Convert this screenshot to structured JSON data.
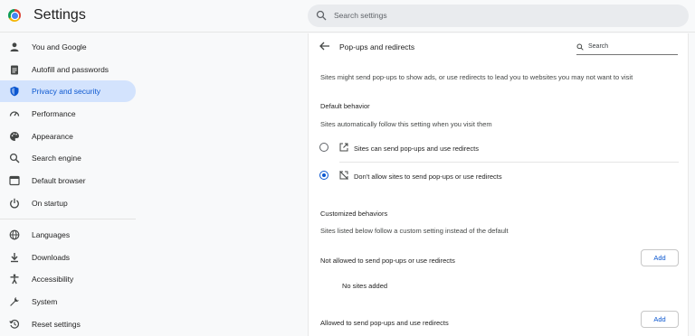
{
  "header": {
    "title": "Settings",
    "search_placeholder": "Search settings"
  },
  "sidebar": {
    "items": [
      {
        "label": "You and Google",
        "icon": "person-icon"
      },
      {
        "label": "Autofill and passwords",
        "icon": "clipboard-icon"
      },
      {
        "label": "Privacy and security",
        "icon": "shield-icon",
        "active": true
      },
      {
        "label": "Performance",
        "icon": "speedometer-icon"
      },
      {
        "label": "Appearance",
        "icon": "palette-icon"
      },
      {
        "label": "Search engine",
        "icon": "search-icon"
      },
      {
        "label": "Default browser",
        "icon": "browser-window-icon"
      },
      {
        "label": "On startup",
        "icon": "power-icon"
      },
      {
        "label": "Languages",
        "icon": "globe-icon"
      },
      {
        "label": "Downloads",
        "icon": "download-icon"
      },
      {
        "label": "Accessibility",
        "icon": "accessibility-icon"
      },
      {
        "label": "System",
        "icon": "wrench-icon"
      },
      {
        "label": "Reset settings",
        "icon": "reset-history-icon"
      }
    ]
  },
  "main": {
    "page_title": "Pop-ups and redirects",
    "search_placeholder": "Search",
    "description": "Sites might send pop-ups to show ads, or use redirects to lead you to websites you may not want to visit",
    "default_behavior": {
      "heading": "Default behavior",
      "subtext": "Sites automatically follow this setting when you visit them",
      "options": [
        {
          "label": "Sites can send pop-ups and use redirects",
          "icon": "open-in-new-icon",
          "selected": false
        },
        {
          "label": "Don't allow sites to send pop-ups or use redirects",
          "icon": "blocked-popup-icon",
          "selected": true
        }
      ]
    },
    "customized": {
      "heading": "Customized behaviors",
      "subtext": "Sites listed below follow a custom setting instead of the default",
      "not_allowed_label": "Not allowed to send pop-ups or use redirects",
      "empty_text": "No sites added",
      "allowed_label": "Allowed to send pop-ups and use redirects",
      "add_label": "Add"
    }
  },
  "colors": {
    "accent": "#0b57d0",
    "active_nav_bg": "#d3e3fd",
    "page_bg": "#f8f9fa"
  }
}
